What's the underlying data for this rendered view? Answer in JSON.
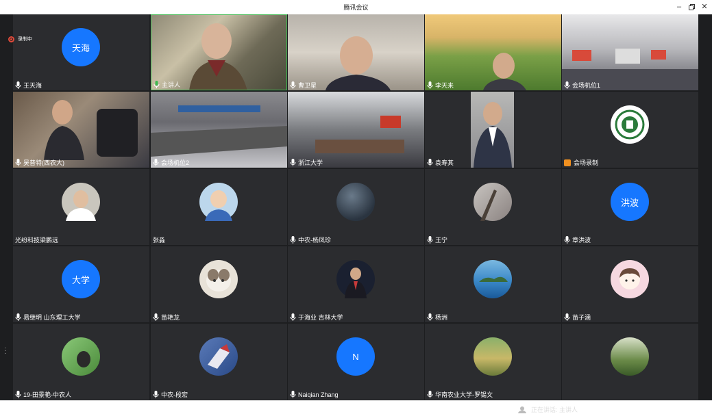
{
  "window": {
    "title": "腾讯会议",
    "min_icon": "minimize-icon",
    "restore_icon": "restore-icon",
    "close_icon": "close-icon"
  },
  "recording": {
    "label": "录制中"
  },
  "speaking": {
    "label": "正在讲话: 主讲人"
  },
  "colors": {
    "avatar_blue": "#1677ff",
    "tile_bg": "#2b2c2f",
    "record_red": "#e04a3a"
  },
  "tiles": [
    {
      "name": "王天海",
      "avatar_text": "天海",
      "kind": "text-avatar"
    },
    {
      "name": "主讲人",
      "kind": "video",
      "mic_active": true
    },
    {
      "name": "曹卫星",
      "kind": "video"
    },
    {
      "name": "李天来",
      "kind": "video"
    },
    {
      "name": "会场机位1",
      "kind": "video"
    },
    {
      "name": "吴普特(西农大)",
      "kind": "video"
    },
    {
      "name": "会场机位2",
      "kind": "video"
    },
    {
      "name": "浙江大学",
      "kind": "video"
    },
    {
      "name": "袁寿其",
      "kind": "video"
    },
    {
      "name": "会场录制",
      "kind": "logo-avatar"
    },
    {
      "name": "光纷科技梁鹏远",
      "kind": "photo-avatar"
    },
    {
      "name": "张淼",
      "kind": "photo-avatar"
    },
    {
      "name": "中农-杨凤珍",
      "kind": "photo-avatar"
    },
    {
      "name": "王宁",
      "kind": "photo-avatar"
    },
    {
      "name": "章洪波",
      "avatar_text": "洪波",
      "kind": "text-avatar"
    },
    {
      "name": "易继明 山东理工大学",
      "avatar_text": "大学",
      "kind": "text-avatar"
    },
    {
      "name": "苗艳龙",
      "kind": "photo-avatar"
    },
    {
      "name": "于海业 吉林大学",
      "kind": "photo-avatar"
    },
    {
      "name": "杨洲",
      "kind": "photo-avatar"
    },
    {
      "name": "苗子涵",
      "kind": "photo-avatar"
    },
    {
      "name": "19-田景艳-中农人",
      "kind": "photo-avatar"
    },
    {
      "name": "中农-段宏",
      "kind": "photo-avatar"
    },
    {
      "name": "Naiqian Zhang",
      "avatar_text": "N",
      "kind": "text-avatar"
    },
    {
      "name": "华南农业大学-罗锡文",
      "kind": "photo-avatar"
    },
    {
      "name": "",
      "kind": "photo-avatar"
    }
  ]
}
